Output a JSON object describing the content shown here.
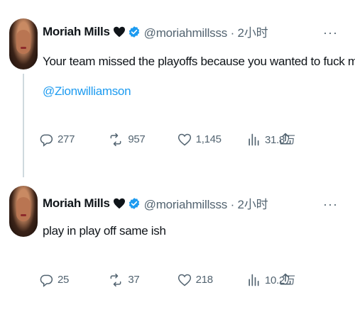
{
  "tweets": [
    {
      "name": "Moriah Mills",
      "handle_time": "@moriahmillsss · 2小时",
      "text": "Your team missed the playoffs because you wanted to fuck me",
      "mention": "@Zionwilliamson",
      "replies": "277",
      "retweets": "957",
      "likes": "1,145",
      "views": "31.8万"
    },
    {
      "name": "Moriah Mills",
      "handle_time": "@moriahmillsss · 2小时",
      "text": "play in play off same ish",
      "replies": "25",
      "retweets": "37",
      "likes": "218",
      "views": "10.2万"
    }
  ],
  "icons": {
    "more": "more-dots-icon",
    "reply": "reply-bubble-icon",
    "retweet": "retweet-icon",
    "like": "heart-icon",
    "views": "views-bar-chart-icon",
    "share": "share-upload-icon",
    "verified": "verified-badge-icon"
  },
  "colors": {
    "accent": "#1d9bf0",
    "secondary_text": "#536471",
    "text": "#0f1419"
  }
}
